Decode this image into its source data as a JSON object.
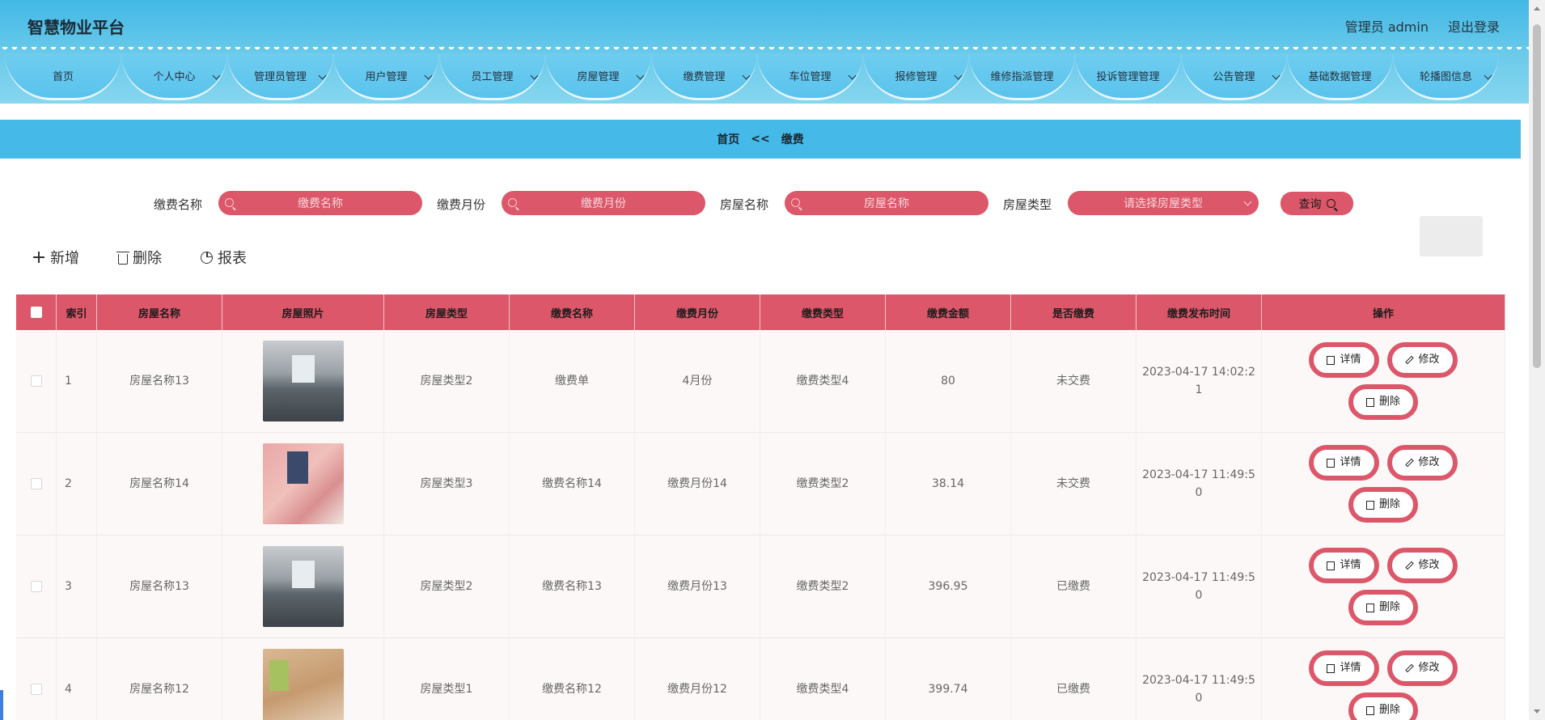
{
  "header": {
    "brand": "智慧物业平台",
    "user": "管理员 admin",
    "logout": "退出登录"
  },
  "nav": [
    {
      "label": "首页",
      "dropdown": false
    },
    {
      "label": "个人中心",
      "dropdown": true
    },
    {
      "label": "管理员管理",
      "dropdown": true
    },
    {
      "label": "用户管理",
      "dropdown": true
    },
    {
      "label": "员工管理",
      "dropdown": true
    },
    {
      "label": "房屋管理",
      "dropdown": true
    },
    {
      "label": "缴费管理",
      "dropdown": true
    },
    {
      "label": "车位管理",
      "dropdown": true
    },
    {
      "label": "报修管理",
      "dropdown": true
    },
    {
      "label": "维修指派管理",
      "dropdown": false
    },
    {
      "label": "投诉管理管理",
      "dropdown": false
    },
    {
      "label": "公告管理",
      "dropdown": true
    },
    {
      "label": "基础数据管理",
      "dropdown": false
    },
    {
      "label": "轮播图信息",
      "dropdown": true
    }
  ],
  "breadcrumb": {
    "home": "首页",
    "sep": "<<",
    "current": "缴费"
  },
  "search": {
    "fee_name_label": "缴费名称",
    "fee_name_placeholder": "缴费名称",
    "fee_month_label": "缴费月份",
    "fee_month_placeholder": "缴费月份",
    "house_name_label": "房屋名称",
    "house_name_placeholder": "房屋名称",
    "house_type_label": "房屋类型",
    "house_type_placeholder": "请选择房屋类型",
    "query": "查询"
  },
  "toolbar": {
    "add": "新增",
    "delete": "删除",
    "report": "报表"
  },
  "table": {
    "headers": [
      "索引",
      "房屋名称",
      "房屋照片",
      "房屋类型",
      "缴费名称",
      "缴费月份",
      "缴费类型",
      "缴费金额",
      "是否缴费",
      "缴费发布时间",
      "操作"
    ],
    "rows": [
      {
        "index": "1",
        "house_name": "房屋名称13",
        "house_type": "房屋类型2",
        "fee_name": "缴费单",
        "fee_month": "4月份",
        "fee_type": "缴费类型4",
        "amount": "80",
        "paid": "未交费",
        "time_a": "2023-04-17 14:02:2",
        "time_b": "1"
      },
      {
        "index": "2",
        "house_name": "房屋名称14",
        "house_type": "房屋类型3",
        "fee_name": "缴费名称14",
        "fee_month": "缴费月份14",
        "fee_type": "缴费类型2",
        "amount": "38.14",
        "paid": "未交费",
        "time_a": "2023-04-17 11:49:5",
        "time_b": "0"
      },
      {
        "index": "3",
        "house_name": "房屋名称13",
        "house_type": "房屋类型2",
        "fee_name": "缴费名称13",
        "fee_month": "缴费月份13",
        "fee_type": "缴费类型2",
        "amount": "396.95",
        "paid": "已缴费",
        "time_a": "2023-04-17 11:49:5",
        "time_b": "0"
      },
      {
        "index": "4",
        "house_name": "房屋名称12",
        "house_type": "房屋类型1",
        "fee_name": "缴费名称12",
        "fee_month": "缴费月份12",
        "fee_type": "缴费类型4",
        "amount": "399.74",
        "paid": "已缴费",
        "time_a": "2023-04-17 11:49:5",
        "time_b": "0"
      }
    ],
    "ops": {
      "detail": "详情",
      "edit": "修改",
      "delete": "删除"
    }
  },
  "colors": {
    "accent": "#dc5769",
    "header_blue": "#45bae9"
  }
}
